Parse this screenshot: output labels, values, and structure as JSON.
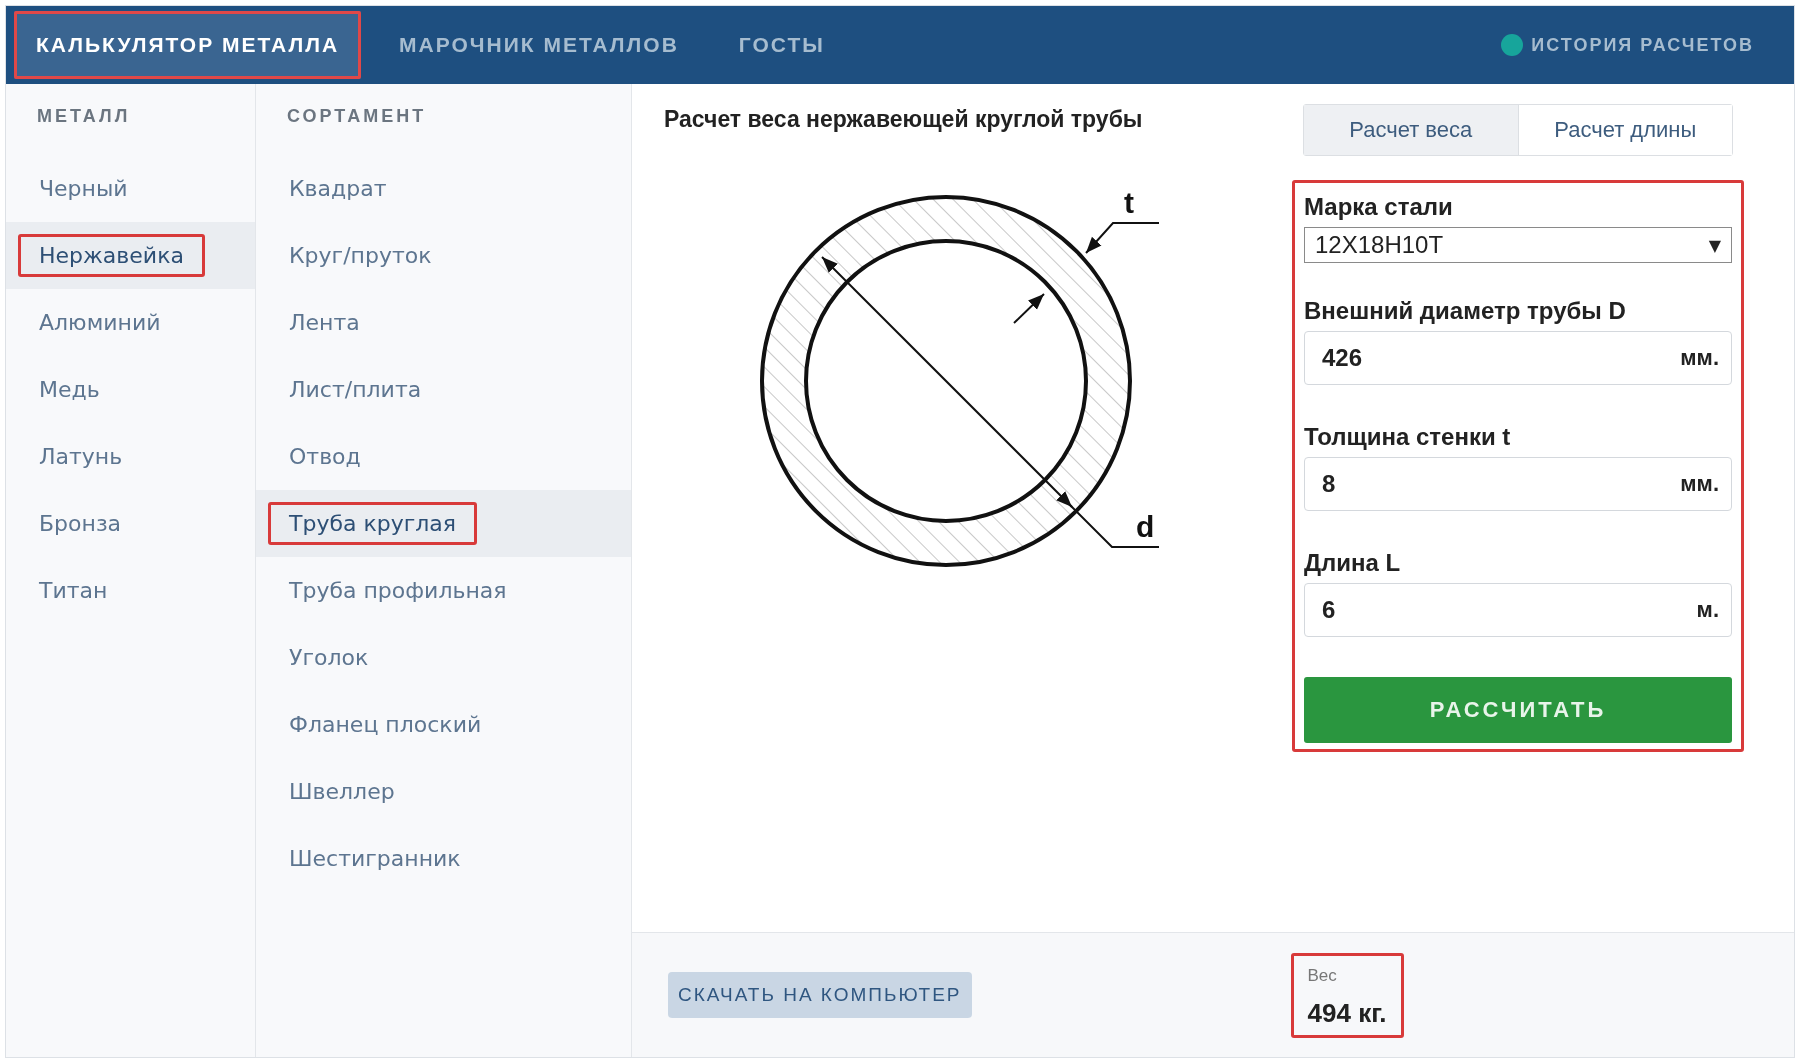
{
  "nav": {
    "tabs": [
      {
        "label": "КАЛЬКУЛЯТОР МЕТАЛЛА",
        "selected": true
      },
      {
        "label": "МАРОЧНИК МЕТАЛЛОВ",
        "selected": false
      },
      {
        "label": "ГОСТЫ",
        "selected": false
      }
    ],
    "history": {
      "label": "ИСТОРИЯ РАСЧЕТОВ",
      "color": "#17a59b"
    }
  },
  "metal": {
    "heading": "МЕТАЛЛ",
    "items": [
      {
        "label": "Черный",
        "selected": false
      },
      {
        "label": "Нержавейка",
        "selected": true
      },
      {
        "label": "Алюминий",
        "selected": false
      },
      {
        "label": "Медь",
        "selected": false
      },
      {
        "label": "Латунь",
        "selected": false
      },
      {
        "label": "Бронза",
        "selected": false
      },
      {
        "label": "Титан",
        "selected": false
      }
    ]
  },
  "assortment": {
    "heading": "СОРТАМЕНТ",
    "items": [
      {
        "label": "Квадрат",
        "selected": false
      },
      {
        "label": "Круг/пруток",
        "selected": false
      },
      {
        "label": "Лента",
        "selected": false
      },
      {
        "label": "Лист/плита",
        "selected": false
      },
      {
        "label": "Отвод",
        "selected": false
      },
      {
        "label": "Труба круглая",
        "selected": true
      },
      {
        "label": "Труба профильная",
        "selected": false
      },
      {
        "label": "Уголок",
        "selected": false
      },
      {
        "label": "Фланец плоский",
        "selected": false
      },
      {
        "label": "Швеллер",
        "selected": false
      },
      {
        "label": "Шестигранник",
        "selected": false
      }
    ]
  },
  "title": "Расчет веса нержавеющей круглой трубы",
  "drawing": {
    "t_label": "t",
    "d_label": "d"
  },
  "mode_tabs": [
    {
      "label": "Расчет веса",
      "selected": true
    },
    {
      "label": "Расчет длины",
      "selected": false
    }
  ],
  "form": {
    "steel": {
      "label": "Марка стали",
      "value": "12Х18Н10Т",
      "arrow": "▼"
    },
    "fields": [
      {
        "label": "Внешний диаметр трубы D",
        "value": "426",
        "unit": "мм."
      },
      {
        "label": "Толщина стенки t",
        "value": "8",
        "unit": "мм."
      },
      {
        "label": "Длина L",
        "value": "6",
        "unit": "м."
      }
    ],
    "submit": "РАССЧИТАТЬ"
  },
  "footer": {
    "download": "СКАЧАТЬ НА КОМПЬЮТЕР",
    "result_label": "Вес",
    "result_value": "494 кг."
  }
}
